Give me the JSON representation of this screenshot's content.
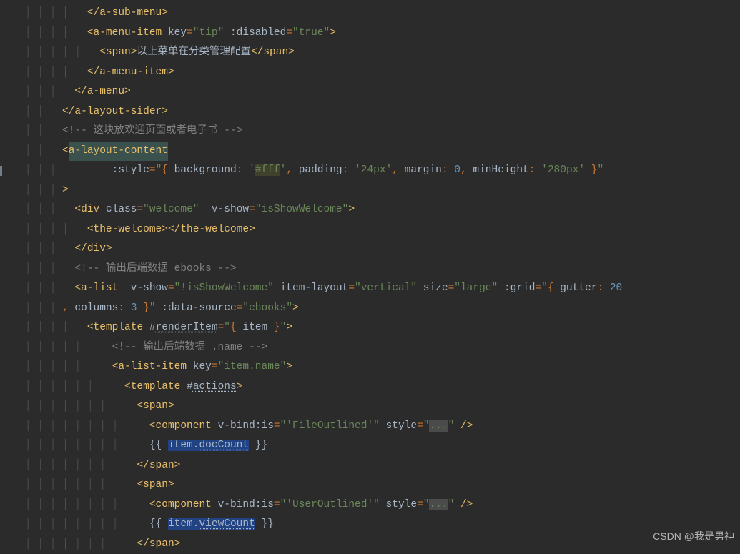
{
  "watermark": "CSDN @我是男神",
  "code": {
    "lines": [
      "</a-sub-menu>",
      "<a-menu-item key=\"tip\" :disabled=\"true\">",
      "  <span>以上菜单在分类管理配置</span>",
      "</a-menu-item>",
      "</a-menu>",
      "</a-layout-sider>",
      "<!-- 这块放欢迎页面或者电子书 -->",
      "<a-layout-content",
      "        :style=\"{ background: '#fff', padding: '24px', margin: 0, minHeight: '280px' }\"",
      ">",
      "<div class=\"welcome\" v-show=\"isShowWelcome\">",
      "  <the-welcome></the-welcome>",
      "</div>",
      "<!-- 输出后端数据 ebooks -->",
      "<a-list  v-show=\"!isShowWelcome\" item-layout=\"vertical\" size=\"large\" :grid=\"{ gutter: 20, columns: 3 }\" :data-source=\"ebooks\">",
      "  <template #renderItem=\"{ item }\">",
      "    <!-- 输出后端数据 .name -->",
      "    <a-list-item key=\"item.name\">",
      "      <template #actions>",
      "        <span>",
      "          <component v-bind:is=\"'FileOutlined'\" style=\"...\" />",
      "          {{ item.docCount }}",
      "        </span>",
      "        <span>",
      "          <component v-bind:is=\"'UserOutlined'\" style=\"...\" />",
      "          {{ item.viewCount }}",
      "        </span>"
    ]
  },
  "tokens": {
    "span": "span",
    "a_sub_menu": "a-sub-menu",
    "a_menu_item": "a-menu-item",
    "a_menu": "a-menu",
    "a_layout_sider": "a-layout-sider",
    "a_layout_content": "a-layout-content",
    "div": "div",
    "the_welcome": "the-welcome",
    "a_list": "a-list",
    "template": "template",
    "a_list_item": "a-list-item",
    "component": "component",
    "key": "key",
    "tip": "tip",
    "disabled": ":disabled",
    "true": "true",
    "menu_text": "以上菜单在分类管理配置",
    "comment1": "!-- 这块放欢迎页面或者电子书 --",
    "style": ":style",
    "background": "background",
    "fff": "#fff",
    "padding": "padding",
    "p24": "24px",
    "margin": "margin",
    "zero": "0",
    "minHeight": "minHeight",
    "h280": "280px",
    "class": "class",
    "welcome": "welcome",
    "vshow": "v-show",
    "isShowWelcome": "isShowWelcome",
    "notIsShowWelcome": "!isShowWelcome",
    "comment2": "!-- 输出后端数据 ebooks --",
    "item_layout": "item-layout",
    "vertical": "vertical",
    "size": "size",
    "large": "large",
    "grid": ":grid",
    "gutter": "gutter",
    "twenty": "20",
    "columns": "columns",
    "three": "3",
    "data_source": ":data-source",
    "ebooks": "ebooks",
    "renderItem": "renderItem",
    "item": "item",
    "comment3": "!-- 输出后端数据 .name --",
    "item_name": "item.name",
    "actions": "actions",
    "vbind": "v-bind",
    "is": ":is",
    "FileOutlined": "FileOutlined",
    "UserOutlined": "UserOutlined",
    "style2": "style",
    "dots": "...",
    "docCount": "docCount",
    "viewCount": "viewCount",
    "open_mustache": "{{ ",
    "close_mustache": " }}",
    "item_dot": "item."
  }
}
